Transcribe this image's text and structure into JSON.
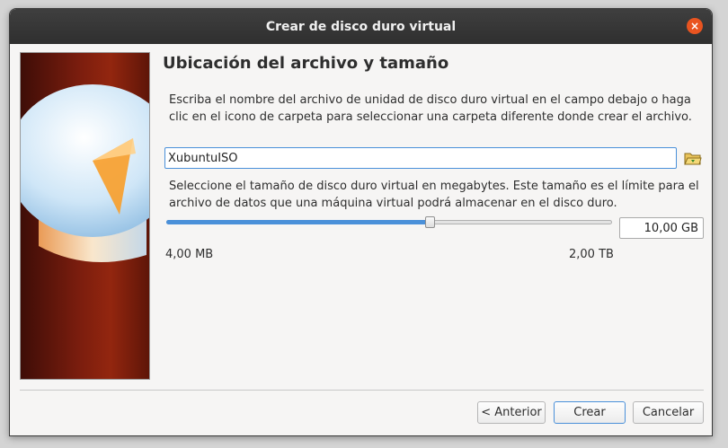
{
  "window": {
    "title": "Crear de disco duro virtual",
    "close_glyph": "×"
  },
  "page": {
    "heading": "Ubicación del archivo y tamaño",
    "location_description": "Escriba el nombre del archivo de unidad de disco duro virtual en el campo debajo o haga clic en el icono de carpeta para seleccionar una carpeta diferente donde crear el archivo.",
    "file_name_value": "XubuntuISO",
    "folder_icon": "folder-open-icon",
    "size_description": "Seleccione el tamaño de disco duro virtual en megabytes. Este tamaño es el límite para el archivo de datos que una máquina virtual podrá almacenar en el disco duro.",
    "slider_position": 0.59,
    "size_value": "10,00 GB",
    "range_min": "4,00 MB",
    "range_max": "2,00 TB"
  },
  "buttons": {
    "back": "< Anterior",
    "create": "Crear",
    "cancel": "Cancelar"
  },
  "colors": {
    "accent": "#4a90d9",
    "close": "#e95420",
    "titlebar": "#333333"
  }
}
